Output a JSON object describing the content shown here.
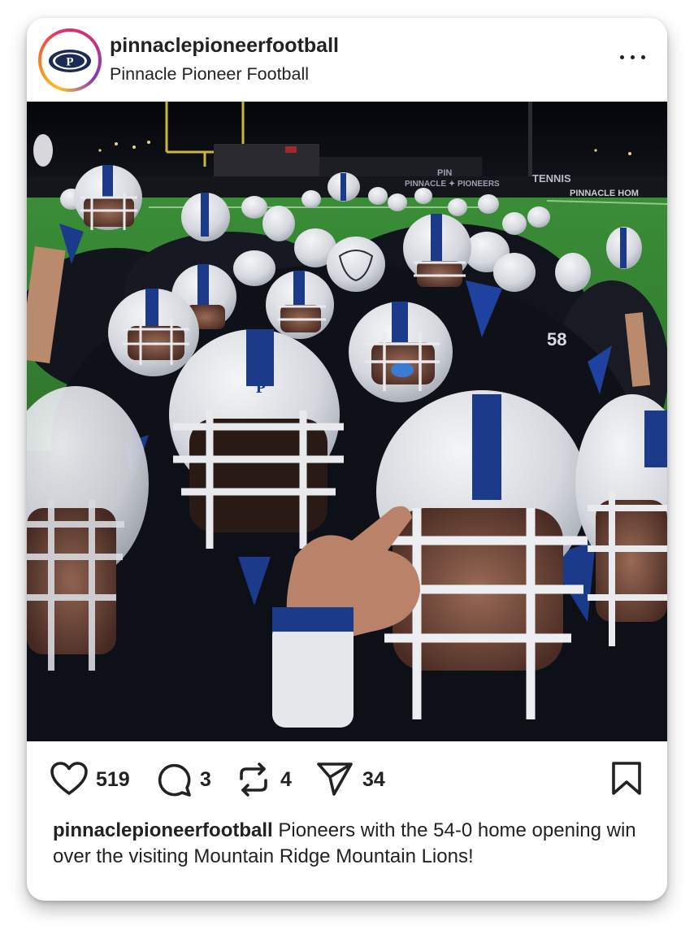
{
  "post": {
    "username": "pinnaclepioneerfootball",
    "display_name": "Pinnacle Pioneer Football",
    "avatar_letter": "P",
    "more_icon": "more-horizontal-icon",
    "photo_signage": {
      "banner_left": "PINNACLE ✦ PIONEERS",
      "banner_mid": "PIN",
      "banner_tennis": "TENNIS",
      "banner_right": "PINNACLE HOM",
      "helmet_letter": "P",
      "jersey_number": "58"
    },
    "actions": {
      "like_icon": "heart-icon",
      "likes": "519",
      "comment_icon": "comment-bubble-icon",
      "comments": "3",
      "repost_icon": "repost-icon",
      "reposts": "4",
      "share_icon": "send-icon",
      "shares": "34",
      "save_icon": "bookmark-icon"
    },
    "caption": {
      "username": "pinnaclepioneerfootball",
      "text": " Pioneers with the 54-0 home opening win over the visiting Mountain Ridge Mountain Lions!"
    }
  },
  "colors": {
    "team_blue": "#1c3a8a",
    "helmet_white": "#e8eaee",
    "night_sky": "#07080d",
    "turf": "#3f9a3b"
  }
}
